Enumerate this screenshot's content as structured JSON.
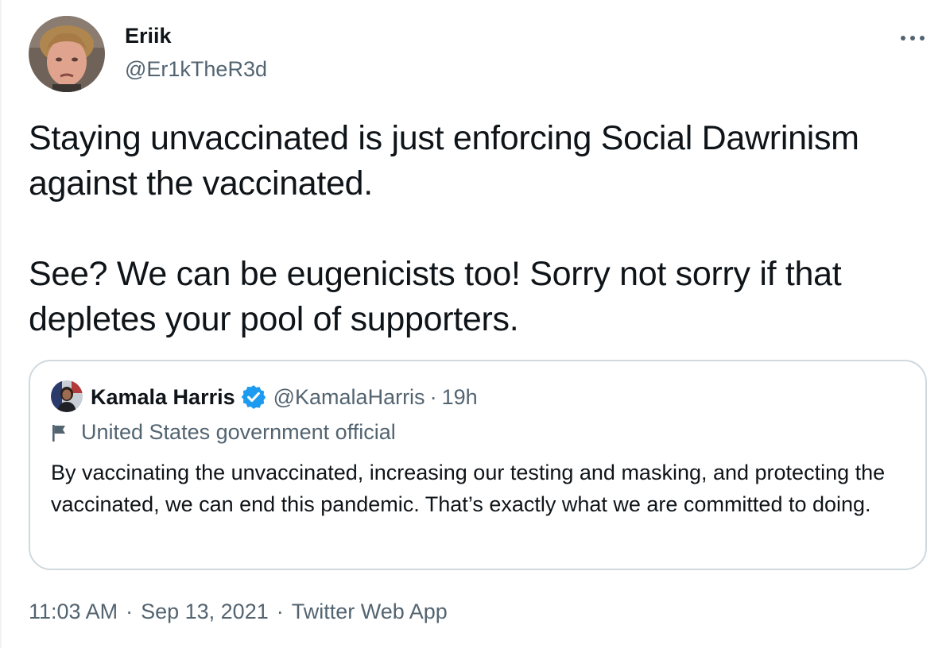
{
  "author": {
    "name": "Eriik",
    "handle": "@Er1kTheR3d"
  },
  "tweet": {
    "paragraphs": [
      "Staying unvaccinated is just enforcing Social Dawrinism against the vaccinated.",
      "See? We can be eugenicists too! Sorry not sorry if that depletes your pool of supporters."
    ]
  },
  "quoted_tweet": {
    "name": "Kamala Harris",
    "handle": "@KamalaHarris",
    "separator": "·",
    "time": "19h",
    "label": "United States government official",
    "text": "By vaccinating the unvaccinated, increasing our testing and masking, and protecting the vaccinated, we can end this pandemic. That’s exactly what we are committed to doing."
  },
  "meta": {
    "time": "11:03 AM",
    "separator": "·",
    "date": "Sep 13, 2021",
    "source": "Twitter Web App"
  },
  "icons": {
    "more": "more-horizontal-icon",
    "verified": "verified-badge-icon",
    "flag": "government-flag-icon"
  },
  "colors": {
    "text_primary": "#0f1419",
    "text_secondary": "#536471",
    "verified_blue": "#1d9bf0",
    "card_border": "#cfd9de"
  }
}
